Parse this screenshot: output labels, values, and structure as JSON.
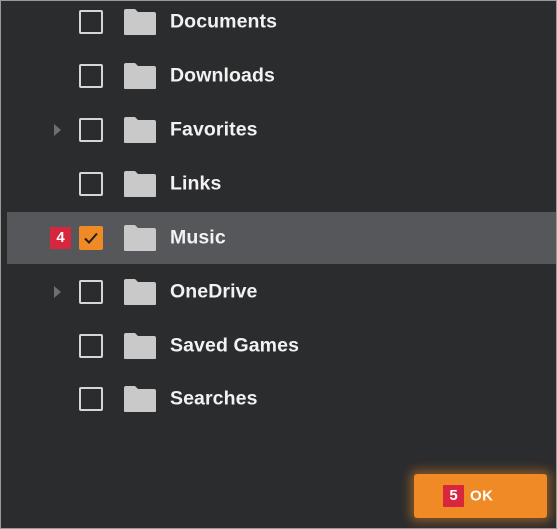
{
  "tree": {
    "items": [
      {
        "label": "Documents",
        "expandable": false,
        "checked": false,
        "selected": false,
        "step": ""
      },
      {
        "label": "Downloads",
        "expandable": false,
        "checked": false,
        "selected": false,
        "step": ""
      },
      {
        "label": "Favorites",
        "expandable": true,
        "checked": false,
        "selected": false,
        "step": ""
      },
      {
        "label": "Links",
        "expandable": false,
        "checked": false,
        "selected": false,
        "step": ""
      },
      {
        "label": "Music",
        "expandable": false,
        "checked": true,
        "selected": true,
        "step": "4"
      },
      {
        "label": "OneDrive",
        "expandable": true,
        "checked": false,
        "selected": false,
        "step": ""
      },
      {
        "label": "Saved Games",
        "expandable": false,
        "checked": false,
        "selected": false,
        "step": ""
      },
      {
        "label": "Searches",
        "expandable": false,
        "checked": false,
        "selected": false,
        "step": ""
      }
    ]
  },
  "ok_button": {
    "label": "OK",
    "step": "5"
  },
  "colors": {
    "accent": "#f08a24",
    "step_badge": "#d7263d",
    "selected_row": "#55575a",
    "background": "#2b2c2e",
    "folder": "#c9c9c9"
  },
  "icons": {
    "folder": "folder-icon",
    "expander": "chevron-right-icon",
    "check": "checkmark-icon"
  }
}
